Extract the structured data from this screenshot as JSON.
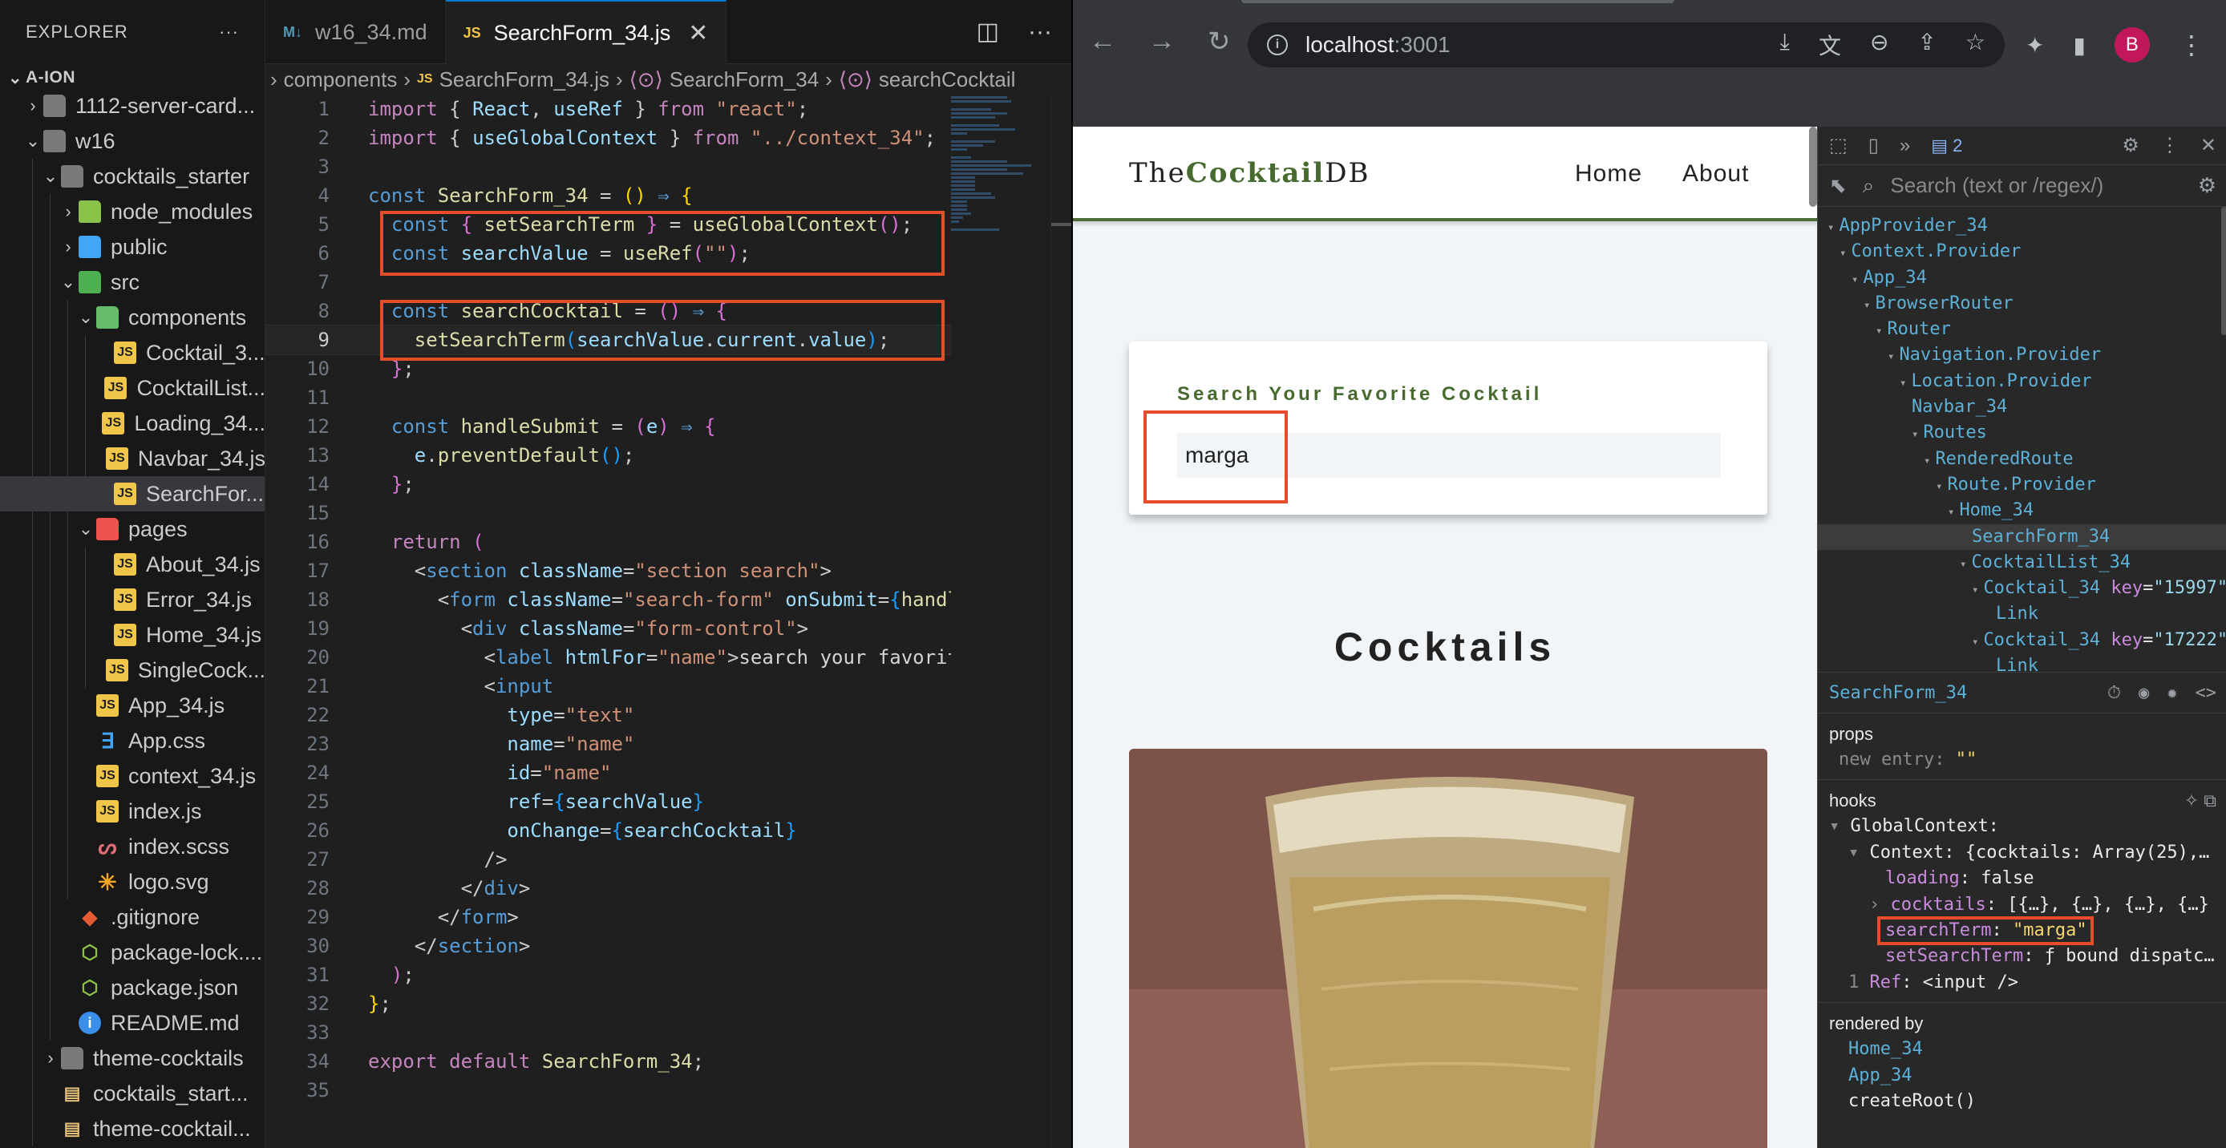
{
  "explorer": {
    "title": "EXPLORER",
    "more": "···",
    "root": "A-ION",
    "items": [
      {
        "label": "1112-server-card...",
        "depth": 1,
        "kind": "folder",
        "chev": "›"
      },
      {
        "label": "w16",
        "depth": 1,
        "kind": "folder",
        "chev": "⌄"
      },
      {
        "label": "cocktails_starter",
        "depth": 2,
        "kind": "folder",
        "chev": "⌄"
      },
      {
        "label": "node_modules",
        "depth": 3,
        "kind": "fnm",
        "chev": "›"
      },
      {
        "label": "public",
        "depth": 3,
        "kind": "fpub",
        "chev": "›"
      },
      {
        "label": "src",
        "depth": 3,
        "kind": "fsrc",
        "chev": "⌄"
      },
      {
        "label": "components",
        "depth": 4,
        "kind": "fcomp",
        "chev": "⌄"
      },
      {
        "label": "Cocktail_3...",
        "depth": 5,
        "kind": "js",
        "chev": ""
      },
      {
        "label": "CocktailList...",
        "depth": 5,
        "kind": "js",
        "chev": ""
      },
      {
        "label": "Loading_34...",
        "depth": 5,
        "kind": "js",
        "chev": ""
      },
      {
        "label": "Navbar_34.js",
        "depth": 5,
        "kind": "js",
        "chev": ""
      },
      {
        "label": "SearchFor...",
        "depth": 5,
        "kind": "js",
        "chev": "",
        "selected": true
      },
      {
        "label": "pages",
        "depth": 4,
        "kind": "fpages",
        "chev": "⌄"
      },
      {
        "label": "About_34.js",
        "depth": 5,
        "kind": "js",
        "chev": ""
      },
      {
        "label": "Error_34.js",
        "depth": 5,
        "kind": "js",
        "chev": ""
      },
      {
        "label": "Home_34.js",
        "depth": 5,
        "kind": "js",
        "chev": ""
      },
      {
        "label": "SingleCock...",
        "depth": 5,
        "kind": "js",
        "chev": ""
      },
      {
        "label": "App_34.js",
        "depth": 4,
        "kind": "js",
        "chev": ""
      },
      {
        "label": "App.css",
        "depth": 4,
        "kind": "css",
        "chev": ""
      },
      {
        "label": "context_34.js",
        "depth": 4,
        "kind": "js",
        "chev": ""
      },
      {
        "label": "index.js",
        "depth": 4,
        "kind": "js",
        "chev": ""
      },
      {
        "label": "index.scss",
        "depth": 4,
        "kind": "scss",
        "chev": ""
      },
      {
        "label": "logo.svg",
        "depth": 4,
        "kind": "svg",
        "chev": ""
      },
      {
        "label": ".gitignore",
        "depth": 3,
        "kind": "git",
        "chev": ""
      },
      {
        "label": "package-lock....",
        "depth": 3,
        "kind": "npm",
        "chev": ""
      },
      {
        "label": "package.json",
        "depth": 3,
        "kind": "npm",
        "chev": ""
      },
      {
        "label": "README.md",
        "depth": 3,
        "kind": "info",
        "chev": ""
      },
      {
        "label": "theme-cocktails",
        "depth": 2,
        "kind": "folder",
        "chev": "›"
      },
      {
        "label": "cocktails_start...",
        "depth": 2,
        "kind": "json-y",
        "chev": ""
      },
      {
        "label": "theme-cocktail...",
        "depth": 2,
        "kind": "json-y",
        "chev": ""
      }
    ]
  },
  "editor_tabs": [
    {
      "icon": "M↓",
      "label": "w16_34.md",
      "active": false
    },
    {
      "icon": "JS",
      "label": "SearchForm_34.js",
      "active": true,
      "close": "✕"
    }
  ],
  "editor_tab_actions": [
    "split-editor-icon",
    "more-icon"
  ],
  "breadcrumb": [
    "components",
    "SearchForm_34.js",
    "SearchForm_34",
    "searchCocktail"
  ],
  "code": {
    "current_line": 9,
    "lines": [
      [
        [
          "kw",
          "import "
        ],
        [
          "pun",
          "{ "
        ],
        [
          "id",
          "React"
        ],
        [
          "pun",
          ", "
        ],
        [
          "id",
          "useRef"
        ],
        [
          "pun",
          " } "
        ],
        [
          "kw",
          "from "
        ],
        [
          "str",
          "\"react\""
        ],
        [
          "pun",
          ";"
        ]
      ],
      [
        [
          "kw",
          "import "
        ],
        [
          "pun",
          "{ "
        ],
        [
          "id",
          "useGlobalContext"
        ],
        [
          "pun",
          " } "
        ],
        [
          "kw",
          "from "
        ],
        [
          "str",
          "\"../context_34\""
        ],
        [
          "pun",
          ";"
        ]
      ],
      [],
      [
        [
          "kw2",
          "const "
        ],
        [
          "fn",
          "SearchForm_34"
        ],
        [
          "pun",
          " = "
        ],
        [
          "br1",
          "()"
        ],
        [
          "kw2",
          " ⇒ "
        ],
        [
          "br1",
          "{"
        ]
      ],
      [
        [
          "pun",
          "  "
        ],
        [
          "kw2",
          "const "
        ],
        [
          "br2",
          "{ "
        ],
        [
          "fn",
          "setSearchTerm"
        ],
        [
          "br2",
          " }"
        ],
        [
          "pun",
          " = "
        ],
        [
          "fn",
          "useGlobalContext"
        ],
        [
          "br2",
          "()"
        ],
        [
          "pun",
          ";"
        ]
      ],
      [
        [
          "pun",
          "  "
        ],
        [
          "kw2",
          "const "
        ],
        [
          "id",
          "searchValue"
        ],
        [
          "pun",
          " = "
        ],
        [
          "fn",
          "useRef"
        ],
        [
          "br2",
          "("
        ],
        [
          "str",
          "\"\""
        ],
        [
          "br2",
          ")"
        ],
        [
          "pun",
          ";"
        ]
      ],
      [],
      [
        [
          "pun",
          "  "
        ],
        [
          "kw2",
          "const "
        ],
        [
          "fn",
          "searchCocktail"
        ],
        [
          "pun",
          " = "
        ],
        [
          "br2",
          "()"
        ],
        [
          "kw2",
          " ⇒ "
        ],
        [
          "br2",
          "{"
        ]
      ],
      [
        [
          "pun",
          "    "
        ],
        [
          "fn",
          "setSearchTerm"
        ],
        [
          "br3",
          "("
        ],
        [
          "id",
          "searchValue"
        ],
        [
          "pun",
          "."
        ],
        [
          "id",
          "current"
        ],
        [
          "pun",
          "."
        ],
        [
          "id",
          "value"
        ],
        [
          "br3",
          ")"
        ],
        [
          "pun",
          ";"
        ]
      ],
      [
        [
          "pun",
          "  "
        ],
        [
          "br2",
          "}"
        ],
        [
          "pun",
          ";"
        ]
      ],
      [],
      [
        [
          "pun",
          "  "
        ],
        [
          "kw2",
          "const "
        ],
        [
          "fn",
          "handleSubmit"
        ],
        [
          "pun",
          " = "
        ],
        [
          "br2",
          "("
        ],
        [
          "id",
          "e"
        ],
        [
          "br2",
          ")"
        ],
        [
          "kw2",
          " ⇒ "
        ],
        [
          "br2",
          "{"
        ]
      ],
      [
        [
          "pun",
          "    "
        ],
        [
          "id",
          "e"
        ],
        [
          "pun",
          "."
        ],
        [
          "fn",
          "preventDefault"
        ],
        [
          "br3",
          "()"
        ],
        [
          "pun",
          ";"
        ]
      ],
      [
        [
          "pun",
          "  "
        ],
        [
          "br2",
          "}"
        ],
        [
          "pun",
          ";"
        ]
      ],
      [],
      [
        [
          "pun",
          "  "
        ],
        [
          "kw",
          "return "
        ],
        [
          "br2",
          "("
        ]
      ],
      [
        [
          "pun",
          "    "
        ],
        [
          "pun",
          "<"
        ],
        [
          "tag",
          "section "
        ],
        [
          "attr",
          "className"
        ],
        [
          "pun",
          "="
        ],
        [
          "str",
          "\"section search\""
        ],
        [
          "pun",
          ">"
        ]
      ],
      [
        [
          "pun",
          "      "
        ],
        [
          "pun",
          "<"
        ],
        [
          "tag",
          "form "
        ],
        [
          "attr",
          "className"
        ],
        [
          "pun",
          "="
        ],
        [
          "str",
          "\"search-form\" "
        ],
        [
          "attr",
          "onSubmit"
        ],
        [
          "pun",
          "="
        ],
        [
          "br3",
          "{"
        ],
        [
          "fn",
          "handle"
        ]
      ],
      [
        [
          "pun",
          "        "
        ],
        [
          "pun",
          "<"
        ],
        [
          "tag",
          "div "
        ],
        [
          "attr",
          "className"
        ],
        [
          "pun",
          "="
        ],
        [
          "str",
          "\"form-control\""
        ],
        [
          "pun",
          ">"
        ]
      ],
      [
        [
          "pun",
          "          "
        ],
        [
          "pun",
          "<"
        ],
        [
          "tag",
          "label "
        ],
        [
          "attr",
          "htmlFor"
        ],
        [
          "pun",
          "="
        ],
        [
          "str",
          "\"name\""
        ],
        [
          "pun",
          ">"
        ],
        [
          "txt",
          "search your favorite"
        ]
      ],
      [
        [
          "pun",
          "          "
        ],
        [
          "pun",
          "<"
        ],
        [
          "tag",
          "input"
        ]
      ],
      [
        [
          "pun",
          "            "
        ],
        [
          "attr",
          "type"
        ],
        [
          "pun",
          "="
        ],
        [
          "str",
          "\"text\""
        ]
      ],
      [
        [
          "pun",
          "            "
        ],
        [
          "attr",
          "name"
        ],
        [
          "pun",
          "="
        ],
        [
          "str",
          "\"name\""
        ]
      ],
      [
        [
          "pun",
          "            "
        ],
        [
          "attr",
          "id"
        ],
        [
          "pun",
          "="
        ],
        [
          "str",
          "\"name\""
        ]
      ],
      [
        [
          "pun",
          "            "
        ],
        [
          "attr",
          "ref"
        ],
        [
          "pun",
          "="
        ],
        [
          "br3",
          "{"
        ],
        [
          "id",
          "searchValue"
        ],
        [
          "br3",
          "}"
        ]
      ],
      [
        [
          "pun",
          "            "
        ],
        [
          "attr",
          "onChange"
        ],
        [
          "pun",
          "="
        ],
        [
          "br3",
          "{"
        ],
        [
          "id",
          "searchCocktail"
        ],
        [
          "br3",
          "}"
        ]
      ],
      [
        [
          "pun",
          "          "
        ],
        [
          "pun",
          "/>"
        ]
      ],
      [
        [
          "pun",
          "        "
        ],
        [
          "pun",
          "</"
        ],
        [
          "tag",
          "div"
        ],
        [
          "pun",
          ">"
        ]
      ],
      [
        [
          "pun",
          "      "
        ],
        [
          "pun",
          "</"
        ],
        [
          "tag",
          "form"
        ],
        [
          "pun",
          ">"
        ]
      ],
      [
        [
          "pun",
          "    "
        ],
        [
          "pun",
          "</"
        ],
        [
          "tag",
          "section"
        ],
        [
          "pun",
          ">"
        ]
      ],
      [
        [
          "pun",
          "  "
        ],
        [
          "br2",
          ")"
        ],
        [
          "pun",
          ";"
        ]
      ],
      [
        [
          "br1",
          "}"
        ],
        [
          "pun",
          ";"
        ]
      ],
      [],
      [
        [
          "kw",
          "export "
        ],
        [
          "kw",
          "default "
        ],
        [
          "fn",
          "SearchForm_34"
        ],
        [
          "pun",
          ";"
        ]
      ],
      []
    ]
  },
  "browser": {
    "url_host": "localhost",
    "url_port": ":3001",
    "avatar": "B",
    "nav_icons": [
      "←",
      "→",
      "↻"
    ],
    "omni_icons": [
      "⤓",
      "文",
      "⊖",
      "⇪",
      "☆"
    ],
    "ext_icons": [
      "✦",
      "▮"
    ]
  },
  "site": {
    "logo_pre": "The",
    "logo_bold": "Cocktail",
    "logo_post": "DB",
    "nav_links": [
      "Home",
      "About"
    ],
    "search_label": "Search Your Favorite Cocktail",
    "search_value": "marga",
    "section_title": "Cocktails"
  },
  "devtools": {
    "badge_count": "2",
    "search_placeholder": "Search (text or /regex/)",
    "tree": [
      {
        "name": "AppProvider_34",
        "depth": 0,
        "tri": "▾"
      },
      {
        "name": "Context.Provider",
        "depth": 1,
        "tri": "▾"
      },
      {
        "name": "App_34",
        "depth": 2,
        "tri": "▾"
      },
      {
        "name": "BrowserRouter",
        "depth": 3,
        "tri": "▾"
      },
      {
        "name": "Router",
        "depth": 4,
        "tri": "▾"
      },
      {
        "name": "Navigation.Provider",
        "depth": 5,
        "tri": "▾"
      },
      {
        "name": "Location.Provider",
        "depth": 6,
        "tri": "▾"
      },
      {
        "name": "Navbar_34",
        "depth": 7,
        "tri": ""
      },
      {
        "name": "Routes",
        "depth": 7,
        "tri": "▾"
      },
      {
        "name": "RenderedRoute",
        "depth": 8,
        "tri": "▾"
      },
      {
        "name": "Route.Provider",
        "depth": 9,
        "tri": "▾"
      },
      {
        "name": "Home_34",
        "depth": 10,
        "tri": "▾"
      },
      {
        "name": "SearchForm_34",
        "depth": 12,
        "tri": "",
        "selected": true
      },
      {
        "name": "CocktailList_34",
        "depth": 11,
        "tri": "▾"
      },
      {
        "name": "Cocktail_34",
        "depth": 12,
        "tri": "▾",
        "key": "15997"
      },
      {
        "name": "Link",
        "depth": 14,
        "tri": ""
      },
      {
        "name": "Cocktail_34",
        "depth": 12,
        "tri": "▾",
        "key": "17222"
      },
      {
        "name": "Link",
        "depth": 14,
        "tri": ""
      }
    ],
    "selected_name": "SearchForm_34",
    "props_title": "props",
    "props": [
      {
        "k": "new entry",
        "v": "\"\""
      }
    ],
    "hooks_title": "hooks",
    "hooks": {
      "global": "GlobalContext:",
      "context": "Context: {cocktails: Array(25),…",
      "loading_k": "loading",
      "loading_v": "false",
      "cocktails_k": "cocktails",
      "cocktails_v": "[{…}, {…}, {…}, {…}",
      "search_k": "searchTerm",
      "search_v": "\"marga\"",
      "set_k": "setSearchTerm",
      "set_v": "ƒ bound dispatc…",
      "ref_idx": "1",
      "ref_k": "Ref",
      "ref_v": "<input />"
    },
    "rendered_title": "rendered by",
    "rendered_by": [
      "Home_34",
      "App_34",
      "createRoot()"
    ]
  }
}
